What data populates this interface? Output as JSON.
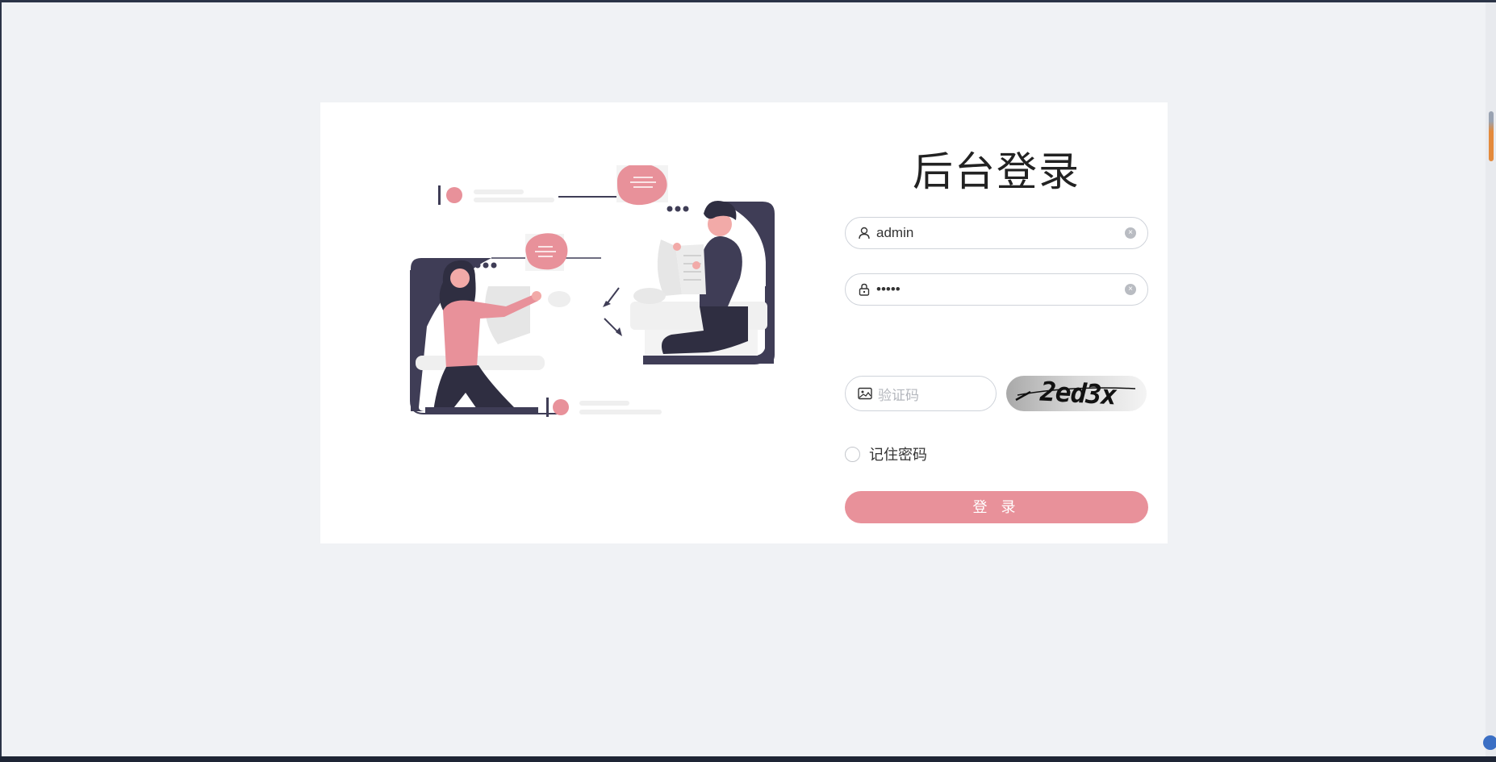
{
  "login": {
    "title": "后台登录",
    "username_value": "admin",
    "password_value": "•••••",
    "captcha_placeholder": "验证码",
    "captcha_code": "2ed3x",
    "remember_label": "记住密码",
    "submit_label": "登 录"
  },
  "icons": {
    "username": "user-icon",
    "password": "lock-icon",
    "captcha": "image-icon",
    "clear": "clear-icon"
  },
  "colors": {
    "accent": "#e8919a",
    "dark": "#3f3d56",
    "background": "#f0f2f5",
    "card": "#ffffff"
  }
}
